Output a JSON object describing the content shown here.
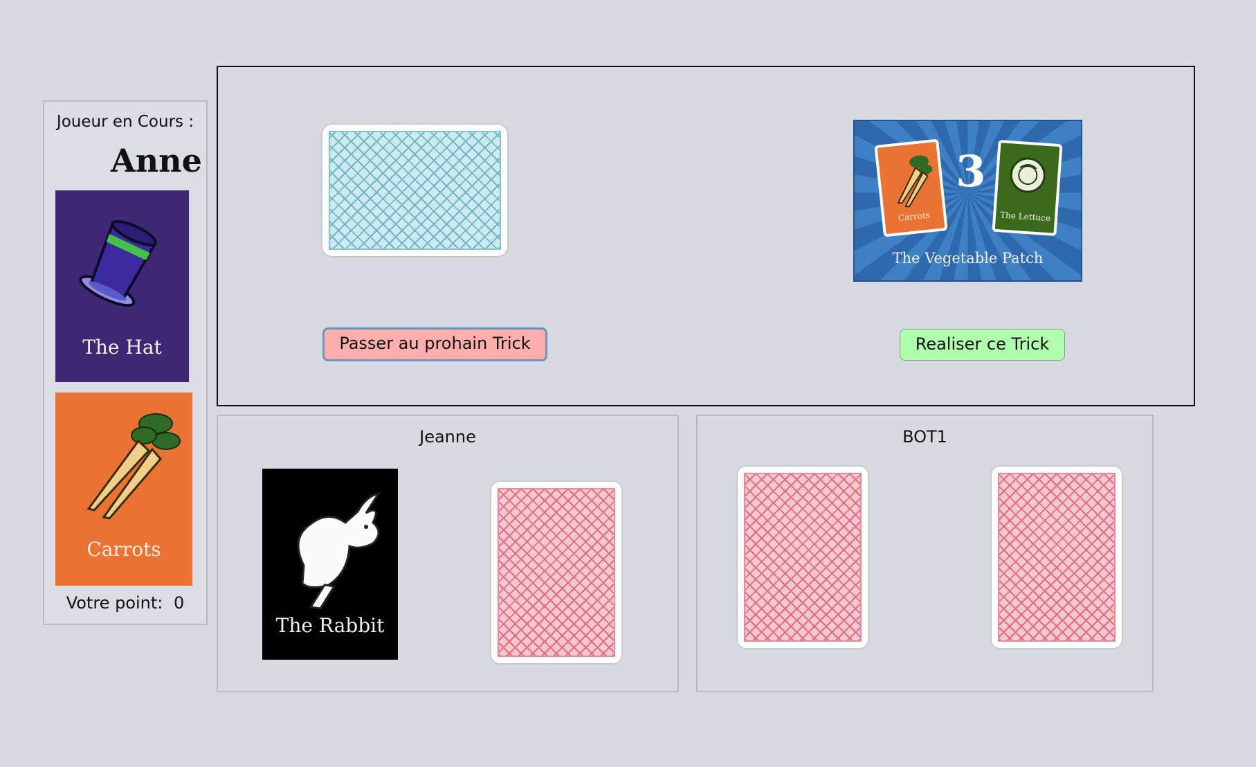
{
  "current_player": {
    "heading": "Joueur en Cours :",
    "name": "Anne",
    "cards": [
      {
        "title": "The Hat",
        "color": "#3e2876",
        "icon": "top-hat-icon"
      },
      {
        "title": "Carrots",
        "color": "#ea7232",
        "icon": "carrots-icon"
      }
    ],
    "score_label": "Votre point:",
    "score_value": "0"
  },
  "trick_area": {
    "skip_button": "Passer au prohain Trick",
    "perform_button": "Realiser ce Trick",
    "trick_card": {
      "number": "3",
      "title": "The Vegetable Patch",
      "left_card": "Carrots",
      "right_card": "The Lettuce"
    },
    "deck_back_color": "#6fb7c7"
  },
  "opponents": [
    {
      "name": "Jeanne",
      "face_up_card": {
        "title": "The Rabbit",
        "color": "#000000",
        "icon": "rabbit-icon"
      },
      "face_down_count": 1
    },
    {
      "name": "BOT1",
      "face_down_count": 2
    }
  ],
  "colors": {
    "skip_button": "#ffaeae",
    "perform_button": "#b0ffae",
    "card_back": "#df6f80"
  }
}
